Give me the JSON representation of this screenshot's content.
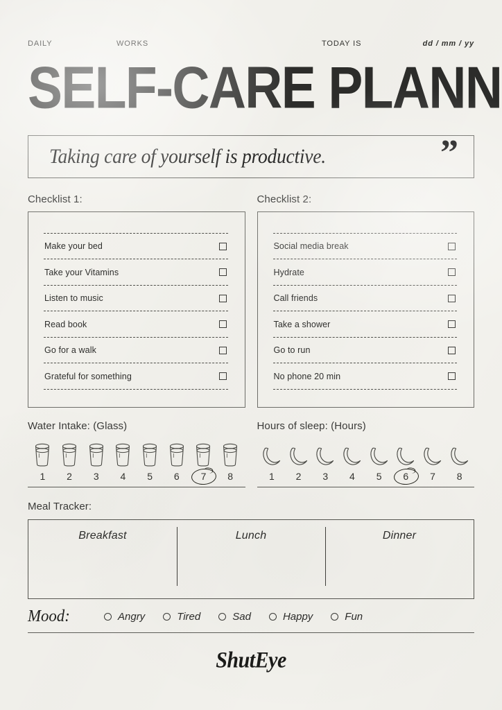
{
  "header": {
    "daily": "DAILY",
    "works": "WORKS",
    "today_is": "TODAY IS",
    "date_placeholder": "dd / mm / yy",
    "title": "SELF-CARE PLANNER"
  },
  "quote": {
    "text": "Taking care of yourself is productive.",
    "mark": "”"
  },
  "checklist1": {
    "label": "Checklist 1:",
    "items": [
      {
        "label": "Make your bed",
        "checked": false
      },
      {
        "label": "Take your Vitamins",
        "checked": false
      },
      {
        "label": "Listen to music",
        "checked": false
      },
      {
        "label": "Read book",
        "checked": false
      },
      {
        "label": "Go for a walk",
        "checked": false
      },
      {
        "label": "Grateful for something",
        "checked": false
      }
    ]
  },
  "checklist2": {
    "label": "Checklist 2:",
    "items": [
      {
        "label": "Social media break",
        "checked": false
      },
      {
        "label": "Hydrate",
        "checked": false
      },
      {
        "label": "Call friends",
        "checked": false
      },
      {
        "label": "Take a shower",
        "checked": false
      },
      {
        "label": "Go to run",
        "checked": false
      },
      {
        "label": "No phone 20 min",
        "checked": false
      }
    ]
  },
  "water": {
    "label": "Water Intake: (Glass)",
    "icon": "water-glass-icon",
    "numbers": [
      "1",
      "2",
      "3",
      "4",
      "5",
      "6",
      "7",
      "8"
    ],
    "selected": "7"
  },
  "sleep": {
    "label": "Hours of sleep: (Hours)",
    "icon": "crescent-moon-icon",
    "numbers": [
      "1",
      "2",
      "3",
      "4",
      "5",
      "6",
      "7",
      "8"
    ],
    "selected": "6"
  },
  "meal": {
    "label": "Meal Tracker:",
    "columns": [
      "Breakfast",
      "Lunch",
      "Dinner"
    ]
  },
  "mood": {
    "label": "Mood:",
    "options": [
      "Angry",
      "Tired",
      "Sad",
      "Happy",
      "Fun"
    ],
    "selected": null
  },
  "footer": {
    "brand": "ShutEye"
  },
  "colors": {
    "paper": "#f2f1ec",
    "ink": "#2b2b2b",
    "rule": "#5d5d58",
    "border": "#6d6d68"
  }
}
